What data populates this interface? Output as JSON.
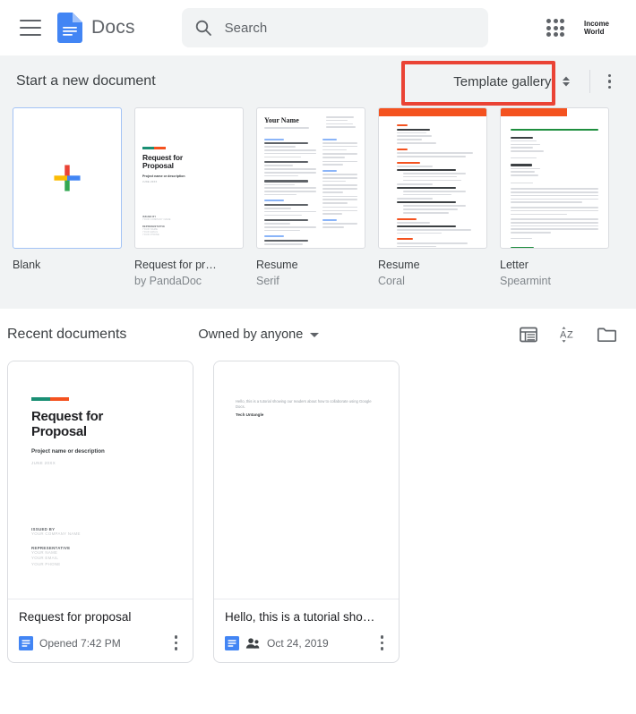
{
  "header": {
    "menu_icon": "hamburger-icon",
    "logo_icon": "google-docs-logo-icon",
    "brand": "Docs",
    "search": {
      "icon": "search-icon",
      "value": "",
      "placeholder": "Search"
    },
    "apps_icon": "apps-grid-icon",
    "avatar_line1": "Income",
    "avatar_line2": "World"
  },
  "templates": {
    "section_title": "Start a new document",
    "gallery_label": "Template gallery",
    "gallery_chevron_icon": "chevron-updown-icon",
    "more_icon": "kebab-menu-icon",
    "highlight_color": "#ea4335",
    "items": [
      {
        "label": "Blank",
        "sub": "",
        "thumb": "blank-plus"
      },
      {
        "label": "Request for pr…",
        "sub": "by PandaDoc",
        "thumb": "request-for-proposal"
      },
      {
        "label": "Resume",
        "sub": "Serif",
        "thumb": "resume-serif"
      },
      {
        "label": "Resume",
        "sub": "Coral",
        "thumb": "resume-coral"
      },
      {
        "label": "Letter",
        "sub": "Spearmint",
        "thumb": "letter-spearmint"
      }
    ],
    "rfp_preview": {
      "title": "Request for\nProposal",
      "subtitle": "Project name or description",
      "date": "JUNE 20XX"
    },
    "resume_serif_preview": {
      "name": "Your Name"
    }
  },
  "recent": {
    "section_title": "Recent documents",
    "filter_label": "Owned by anyone",
    "filter_caret_icon": "caret-down-icon",
    "list_view_icon": "list-view-icon",
    "sort_icon": "sort-az-icon",
    "folder_icon": "folder-icon",
    "documents": [
      {
        "title": "Request for proposal",
        "time": "Opened 7:42 PM",
        "doc_icon": "google-docs-file-icon",
        "shared": false,
        "more_icon": "kebab-menu-icon",
        "preview": {
          "heading": "Request for\nProposal",
          "subtitle": "Project name or description",
          "date": "JUNE 20XX",
          "issued_by_label": "ISSUED BY",
          "issued_by_value": "YOUR COMPANY NAME",
          "rep_label": "REPRESENTATIVE",
          "rep_name": "YOUR NAME",
          "rep_email": "YOUR EMAIL",
          "rep_phone": "YOUR PHONE"
        }
      },
      {
        "title": "Hello, this is a tutorial sho…",
        "time": "Oct 24, 2019",
        "doc_icon": "google-docs-file-icon",
        "shared": true,
        "shared_icon": "people-shared-icon",
        "more_icon": "kebab-menu-icon",
        "preview": {
          "line1": "Hello, this is a tutorial showing our readers about how to collaborate using Google Docs.",
          "line2": "Tech Untangle"
        }
      }
    ]
  }
}
